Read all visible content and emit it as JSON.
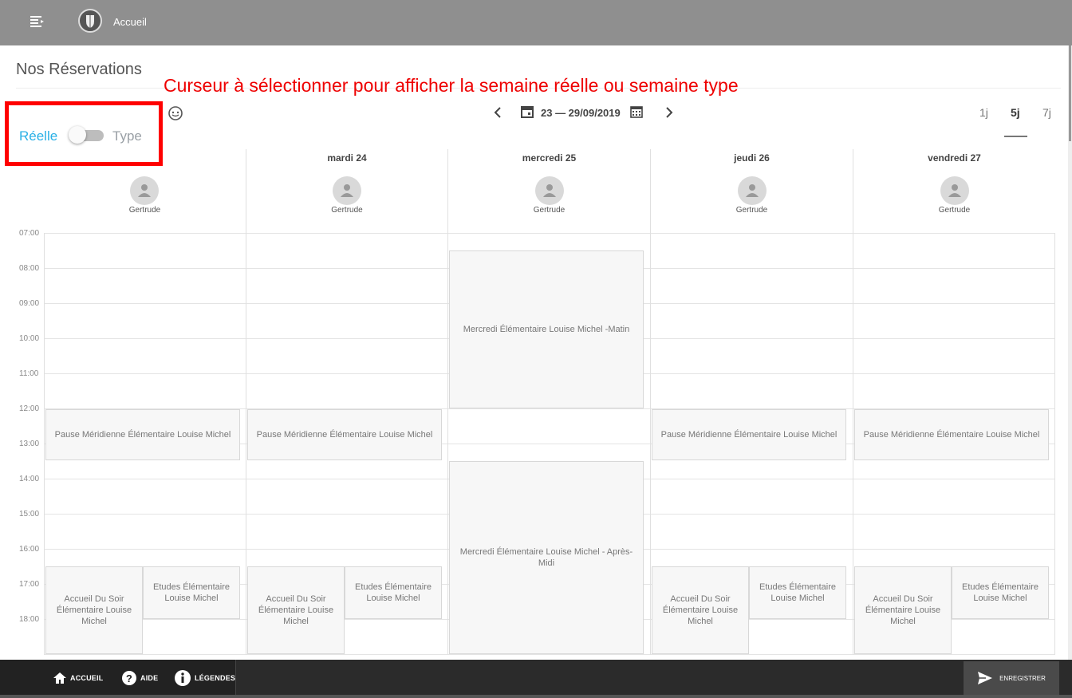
{
  "topbar": {
    "title": "Accueil",
    "menu_icon": "menu-icon",
    "logo": "crest-logo"
  },
  "page": {
    "title": "Nos Réservations"
  },
  "annotation": {
    "text": "Curseur à sélectionner pour afficher la semaine réelle ou semaine type",
    "color": "#ee0000"
  },
  "toggle": {
    "label_on": "Réelle",
    "label_off": "Type",
    "state": "Réelle"
  },
  "navigation": {
    "date_range": "23 — 29/09/2019"
  },
  "views": [
    {
      "label": "1j"
    },
    {
      "label": "5j",
      "active": true
    },
    {
      "label": "7j"
    }
  ],
  "days": [
    {
      "name": "",
      "person": "Gertrude"
    },
    {
      "name": "mardi  24",
      "person": "Gertrude"
    },
    {
      "name": "mercredi  25",
      "person": "Gertrude"
    },
    {
      "name": "jeudi  26",
      "person": "Gertrude"
    },
    {
      "name": "vendredi  27",
      "person": "Gertrude"
    }
  ],
  "hours": [
    "07:00",
    "08:00",
    "09:00",
    "10:00",
    "11:00",
    "12:00",
    "13:00",
    "14:00",
    "15:00",
    "16:00",
    "17:00",
    "18:00"
  ],
  "events": {
    "pause_meridienne": "Pause Méridienne Élémentaire Louise Michel",
    "accueil_soir": "Accueil Du Soir Élémentaire Louise Michel",
    "etudes": "Etudes Élémentaire Louise Michel",
    "mercredi_matin": "Mercredi Élémentaire Louise Michel -Matin",
    "mercredi_apres_midi": "Mercredi Élémentaire Louise Michel - Après-Midi"
  },
  "footer": {
    "accueil": "ACCUEIL",
    "aide": "AIDE",
    "legendes": "LÉGENDES",
    "enregistrer": "ENREGISTRER"
  },
  "colors": {
    "topbar": "#8f8f8f",
    "accent": "#2ab0e6",
    "footer": "#2b2b2b"
  }
}
